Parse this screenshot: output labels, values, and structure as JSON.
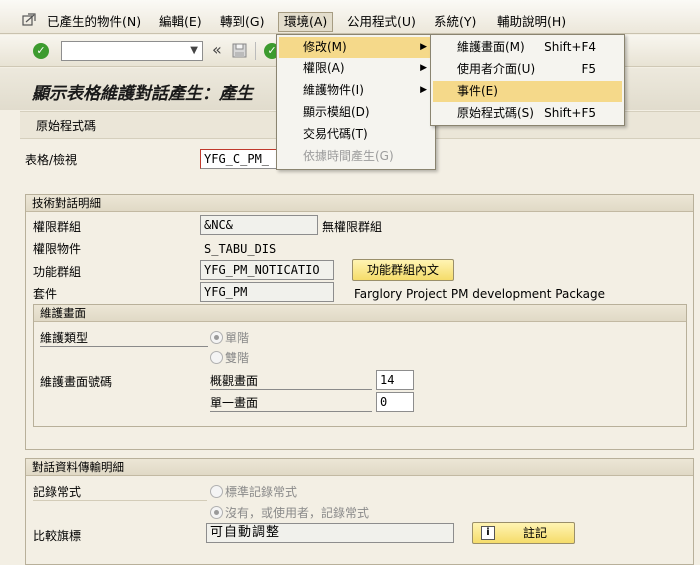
{
  "menubar": {
    "items": [
      {
        "label": "已產生的物件(N)"
      },
      {
        "label": "編輯(E)"
      },
      {
        "label": "轉到(G)"
      },
      {
        "label": "環境(A)"
      },
      {
        "label": "公用程式(U)"
      },
      {
        "label": "系統(Y)"
      },
      {
        "label": "輔助說明(H)"
      }
    ]
  },
  "toolbar": {
    "back_glyph": "«"
  },
  "title": "顯示表格維護對話產生：產生",
  "app_toolbar": {
    "source_code_button": "原始程式碼"
  },
  "form": {
    "table_view_label": "表格/檢視",
    "table_view_value": "YFG_C_PM_"
  },
  "technical": {
    "header": "技術對話明細",
    "auth_group_label": "權限群組",
    "auth_group_value": "&NC&",
    "auth_group_desc": "無權限群組",
    "auth_object_label": "權限物件",
    "auth_object_value": "S_TABU_DIS",
    "function_group_label": "功能群組",
    "function_group_value": "YFG_PM_NOTICATIO",
    "function_group_button": "功能群組內文",
    "package_label": "套件",
    "package_value": "YFG_PM",
    "package_desc": "Farglory Project PM development Package"
  },
  "maintenance_screen": {
    "header": "維護畫面",
    "type_label": "維護類型",
    "radio_single": "單階",
    "radio_double": "雙階",
    "screen_number_label": "維護畫面號碼",
    "overview_label": "概觀畫面",
    "overview_value": "14",
    "single_label": "單一畫面",
    "single_value": "0"
  },
  "transport": {
    "header": "對話資料傳輸明細",
    "routine_label": "記錄常式",
    "radio_standard": "標準記錄常式",
    "radio_none": "沒有，或使用者，記錄常式",
    "compare_label": "比較旗標",
    "compare_value": "可自動調整",
    "log_button": "註記"
  },
  "env_menu": {
    "items": [
      {
        "label": "修改(M)"
      },
      {
        "label": "權限(A)"
      },
      {
        "label": "維護物件(I)"
      },
      {
        "label": "顯示模組(D)"
      },
      {
        "label": "交易代碼(T)"
      },
      {
        "label": "依據時間產生(G)"
      }
    ]
  },
  "modify_submenu": {
    "items": [
      {
        "label": "維護畫面(M)",
        "shortcut": "Shift+F4"
      },
      {
        "label": "使用者介面(U)",
        "shortcut": "F5"
      },
      {
        "label": "事件(E)",
        "shortcut": ""
      },
      {
        "label": "原始程式碼(S)",
        "shortcut": "Shift+F5"
      }
    ]
  },
  "colors": {
    "highlight": "#f5d98a",
    "accent_green": "#3d9b2f"
  }
}
